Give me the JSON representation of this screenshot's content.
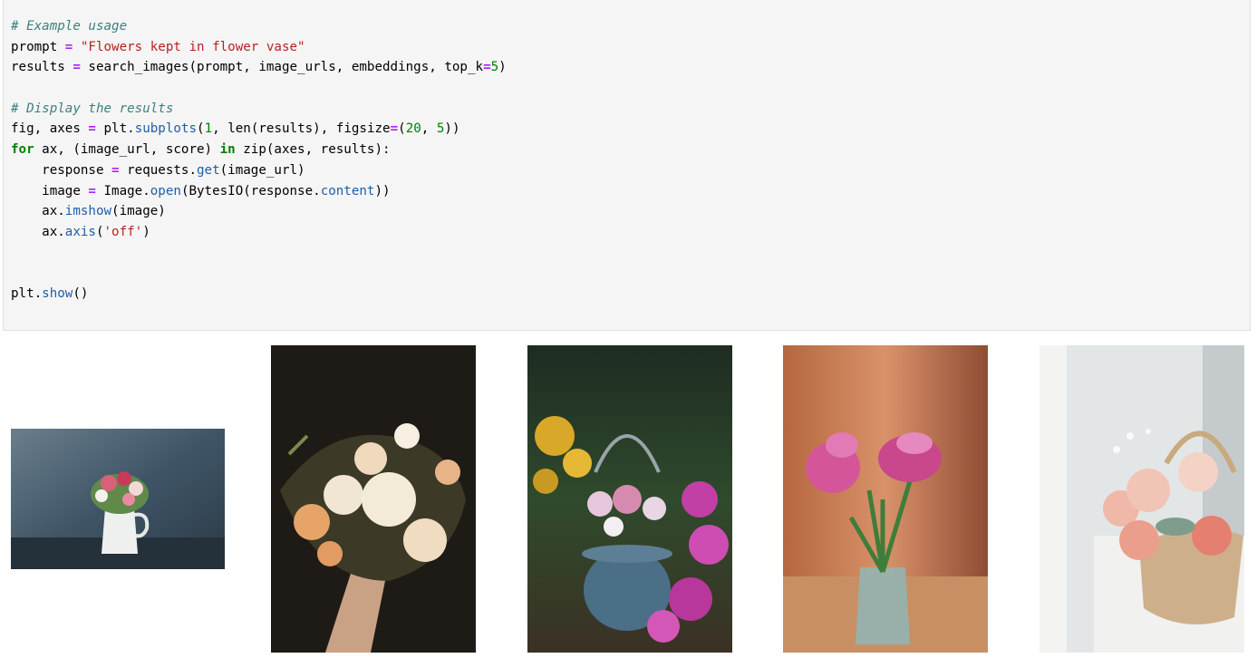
{
  "code_cell": {
    "lines": [
      [
        {
          "t": "# Example usage",
          "c": "comment"
        }
      ],
      [
        {
          "t": "prompt "
        },
        {
          "t": "=",
          "c": "op"
        },
        {
          "t": " "
        },
        {
          "t": "\"Flowers kept in flower vase\"",
          "c": "str"
        }
      ],
      [
        {
          "t": "results "
        },
        {
          "t": "=",
          "c": "op"
        },
        {
          "t": " search_images(prompt, image_urls, embeddings, top_k"
        },
        {
          "t": "=",
          "c": "op"
        },
        {
          "t": "5",
          "c": "num"
        },
        {
          "t": ")"
        }
      ],
      [],
      [
        {
          "t": "# Display the results",
          "c": "comment"
        }
      ],
      [
        {
          "t": "fig, axes "
        },
        {
          "t": "=",
          "c": "op"
        },
        {
          "t": " plt."
        },
        {
          "t": "subplots",
          "c": "attr"
        },
        {
          "t": "("
        },
        {
          "t": "1",
          "c": "num"
        },
        {
          "t": ", len(results), figsize"
        },
        {
          "t": "=",
          "c": "op"
        },
        {
          "t": "("
        },
        {
          "t": "20",
          "c": "num"
        },
        {
          "t": ", "
        },
        {
          "t": "5",
          "c": "num"
        },
        {
          "t": "))"
        }
      ],
      [
        {
          "t": "for",
          "c": "kw"
        },
        {
          "t": " ax, (image_url, score) "
        },
        {
          "t": "in",
          "c": "kw"
        },
        {
          "t": " zip(axes, results):"
        }
      ],
      [
        {
          "t": "    response "
        },
        {
          "t": "=",
          "c": "op"
        },
        {
          "t": " requests."
        },
        {
          "t": "get",
          "c": "attr"
        },
        {
          "t": "(image_url)"
        }
      ],
      [
        {
          "t": "    image "
        },
        {
          "t": "=",
          "c": "op"
        },
        {
          "t": " Image."
        },
        {
          "t": "open",
          "c": "attr"
        },
        {
          "t": "(BytesIO(response."
        },
        {
          "t": "content",
          "c": "attr"
        },
        {
          "t": "))"
        }
      ],
      [
        {
          "t": "    ax."
        },
        {
          "t": "imshow",
          "c": "attr"
        },
        {
          "t": "(image)"
        }
      ],
      [
        {
          "t": "    ax."
        },
        {
          "t": "axis",
          "c": "attr"
        },
        {
          "t": "("
        },
        {
          "t": "'off'",
          "c": "str"
        },
        {
          "t": ")"
        }
      ],
      [],
      [],
      [
        {
          "t": "plt."
        },
        {
          "t": "show",
          "c": "attr"
        },
        {
          "t": "()"
        }
      ]
    ]
  },
  "output": {
    "images": [
      {
        "name": "result-image-1",
        "subject": "white pitcher vase with pink and white roses on dark blue background"
      },
      {
        "name": "result-image-2",
        "subject": "hand holding bouquet of cream and peach roses on dark background"
      },
      {
        "name": "result-image-3",
        "subject": "blue woven basket with pink roses among magenta and yellow flowers"
      },
      {
        "name": "result-image-4",
        "subject": "pink tulips in clear glass vase on wooden table"
      },
      {
        "name": "result-image-5",
        "subject": "woven straw basket with pink roses and baby's breath by window"
      }
    ]
  },
  "colors": {
    "code_background": "#f5f5f5",
    "comment": "#3f7f7f",
    "string": "#ba2121",
    "operator": "#aa22ff",
    "number": "#008000",
    "keyword": "#008000",
    "attribute": "#1f5ea8"
  }
}
